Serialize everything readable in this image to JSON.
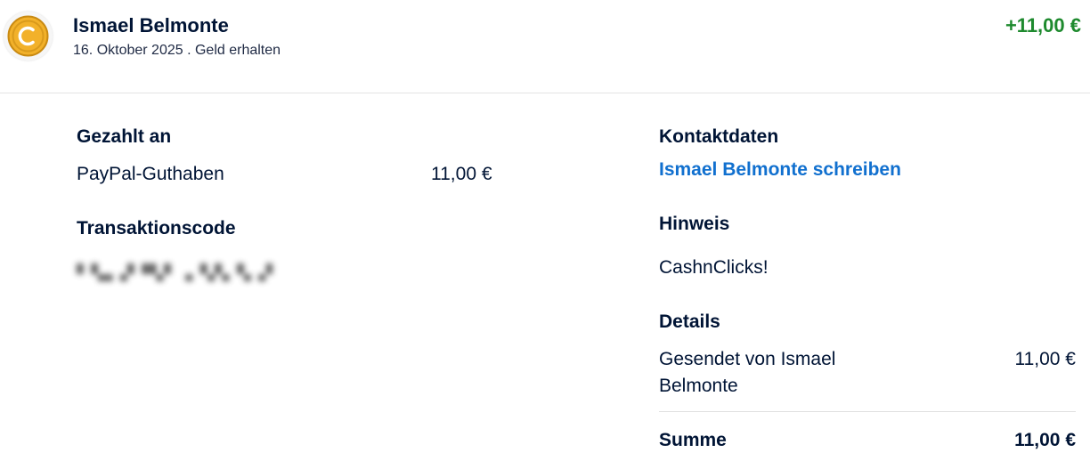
{
  "header": {
    "name": "Ismael Belmonte",
    "subline": "16. Oktober 2025 . Geld erhalten",
    "amount": "+11,00 €",
    "icon": "coin-icon",
    "amount_color": "#1e8a2e"
  },
  "left": {
    "paid_to_heading": "Gezahlt an",
    "paid_to_method": "PayPal-Guthaben",
    "paid_to_amount": "11,00 €",
    "transaction_heading": "Transaktionscode"
  },
  "right": {
    "contact_heading": "Kontaktdaten",
    "contact_link": "Ismael Belmonte schreiben",
    "note_heading": "Hinweis",
    "note_text": "CashnClicks!",
    "details_heading": "Details",
    "details_line1": "Gesendet von Ismael",
    "details_line2": "Belmonte",
    "details_amount": "11,00 €",
    "sum_label": "Summe",
    "sum_amount": "11,00 €"
  },
  "colors": {
    "link": "#1170cf",
    "text": "#001435"
  }
}
